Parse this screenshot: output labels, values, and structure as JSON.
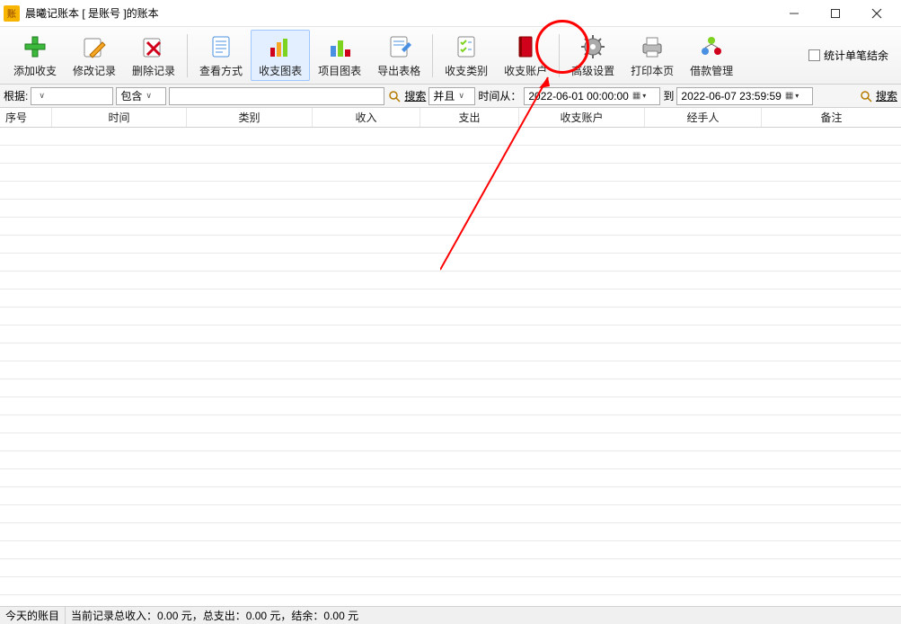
{
  "title": "晨曦记账本    [ 是账号 ]的账本",
  "app_icon_text": "账",
  "toolbar": {
    "add": "添加收支",
    "edit": "修改记录",
    "delete": "删除记录",
    "view_mode": "查看方式",
    "chart_income": "收支图表",
    "chart_project": "项目图表",
    "export": "导出表格",
    "category": "收支类别",
    "account": "收支账户",
    "advanced": "高级设置",
    "print": "打印本页",
    "loan": "借款管理",
    "stat_checkbox": "统计单笔结余"
  },
  "search": {
    "basis_label": "根据:",
    "basis_value": "",
    "contain_value": "包含",
    "text_value": "",
    "search_btn1": "搜索",
    "and_value": "并且",
    "time_from_label": "时间从：",
    "date_from": "2022-06-01 00:00:00",
    "to_label": "到",
    "date_to": "2022-06-07 23:59:59",
    "search_btn2": "搜索"
  },
  "columns": {
    "index": "序号",
    "time": "时间",
    "category": "类别",
    "income": "收入",
    "expense": "支出",
    "account": "收支账户",
    "handler": "经手人",
    "remark": "备注"
  },
  "status": {
    "today": "今天的账目",
    "summary": "当前记录总收入：0.00 元，总支出：0.00 元，结余：0.00 元"
  }
}
